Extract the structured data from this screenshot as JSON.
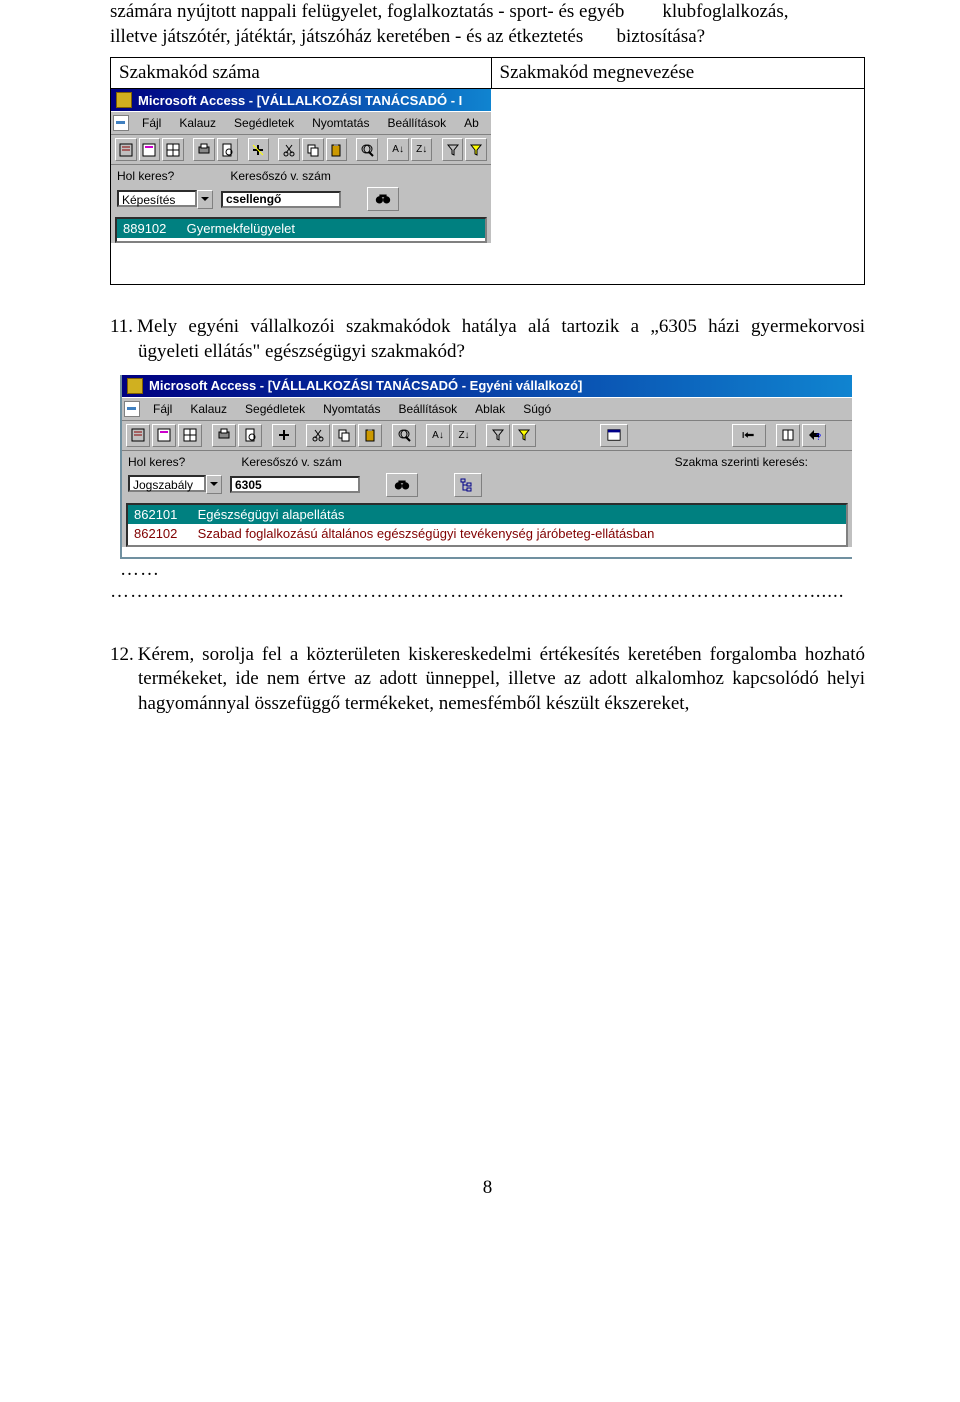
{
  "intro": {
    "line1a": "számára nyújtott nappali felügyelet, foglalkoztatás - sport- és egyéb",
    "line1b": "klubfoglalkozás,",
    "line2a": "illetve játszótér, játéktár,  játszóház keretében - és az étkeztetés",
    "line2b": "biztosítása?"
  },
  "table": {
    "h1": "Szakmakód száma",
    "h2": "Szakmakód megnevezése"
  },
  "shot1": {
    "title": "Microsoft Access - [VÁLLALKOZÁSI TANÁCSADÓ - I",
    "menu": [
      "Fájl",
      "Kalauz",
      "Segédletek",
      "Nyomtatás",
      "Beállítások",
      "Ab"
    ],
    "hol_label": "Hol keres?",
    "hol_value": "Képesítés",
    "ker_label": "Keresőszó v. szám",
    "ker_value": "csellengő",
    "result_code": "889102",
    "result_text": "Gyermekfelügyelet"
  },
  "q11": {
    "num": "11.",
    "text": "Mely egyéni vállalkozói szakmakódok hatálya alá tartozik a „6305 házi gyermekorvosi ügyeleti ellátás\" egészségügyi szakmakód?"
  },
  "shot2": {
    "title": "Microsoft Access - [VÁLLALKOZÁSI TANÁCSADÓ - Egyéni vállalkozó]",
    "menu": [
      "Fájl",
      "Kalauz",
      "Segédletek",
      "Nyomtatás",
      "Beállítások",
      "Ablak",
      "Súgó"
    ],
    "hol_label": "Hol keres?",
    "hol_value": "Jogszabály",
    "ker_label": "Keresőszó v. szám",
    "ker_value": "6305",
    "szakma_label": "Szakma szerinti keresés:",
    "r1_code": "862101",
    "r1_text": "Egészségügyi alapellátás",
    "r2_code": "862102",
    "r2_text": "Szabad foglalkozású általános egészségügyi tevékenység járóbeteg-ellátásban"
  },
  "dots1": "……",
  "dots2": "……………………………………………………………………………………………......",
  "q12": {
    "num": "12.",
    "text": "Kérem, sorolja fel a közterületen kiskereskedelmi értékesítés keretében forgalomba hozható termékeket, ide nem értve az adott ünneppel, illetve az adott alkalomhoz kapcsolódó helyi hagyománnyal összefüggő termékeket, nemesfémből készült ékszereket,"
  },
  "page_number": "8"
}
